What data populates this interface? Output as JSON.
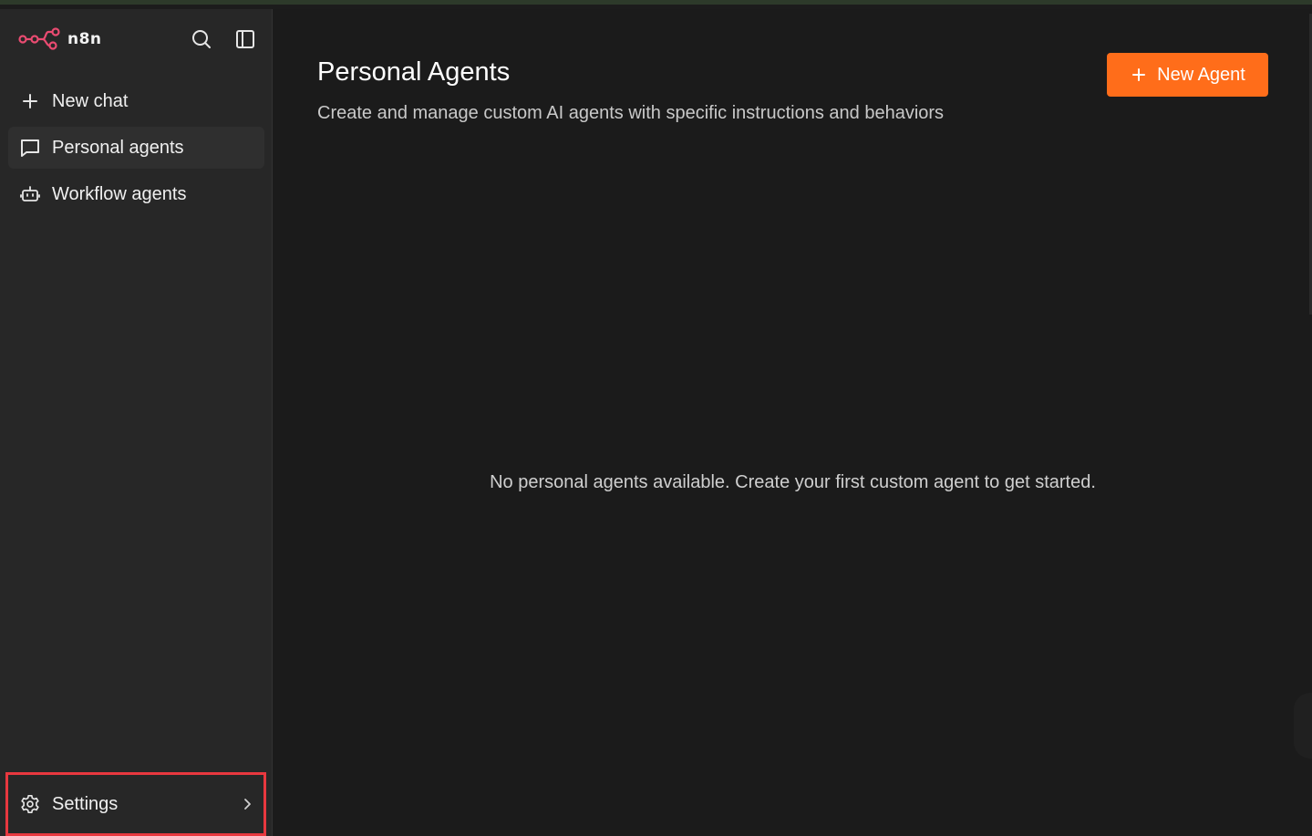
{
  "app": {
    "logo_text": "n8n",
    "accent_color": "#ff6d1a",
    "logo_color": "#ea4b71"
  },
  "sidebar": {
    "search_icon": "search-icon",
    "panel_icon": "sidebar-toggle-icon",
    "items": [
      {
        "label": "New chat",
        "icon": "plus-icon",
        "active": false
      },
      {
        "label": "Personal agents",
        "icon": "chat-bubble-icon",
        "active": true
      },
      {
        "label": "Workflow agents",
        "icon": "robot-icon",
        "active": false
      }
    ],
    "settings_label": "Settings"
  },
  "main": {
    "title": "Personal Agents",
    "subtitle": "Create and manage custom AI agents with specific instructions and behaviors",
    "new_agent_label": "New Agent",
    "empty_state": "No personal agents available. Create your first custom agent to get started."
  }
}
